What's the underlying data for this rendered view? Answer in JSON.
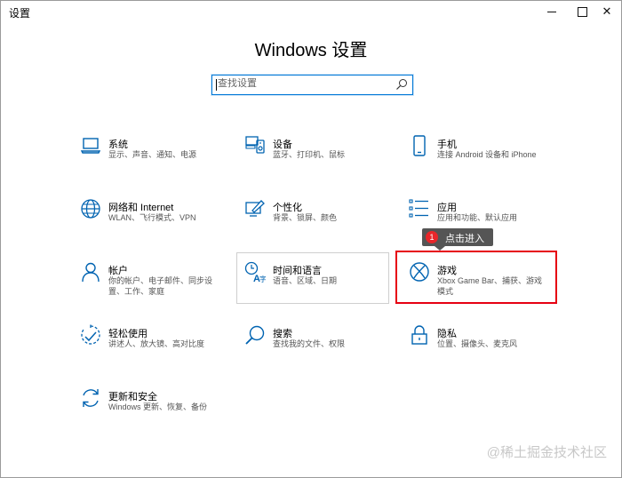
{
  "window": {
    "title": "设置",
    "minimize_glyph": "",
    "maximize_glyph": "",
    "close_glyph": "✕"
  },
  "header": {
    "title": "Windows 设置"
  },
  "search": {
    "value": "",
    "placeholder": "查找设置",
    "icon": "search-icon"
  },
  "accent_color": "#0078d7",
  "highlight_color": "#e60012",
  "tiles": [
    {
      "name": "系统",
      "desc": "显示、声音、通知、电源",
      "icon": "laptop-icon"
    },
    {
      "name": "设备",
      "desc": "蓝牙、打印机、鼠标",
      "icon": "devices-icon"
    },
    {
      "name": "手机",
      "desc": "连接 Android 设备和 iPhone",
      "icon": "phone-icon"
    },
    {
      "name": "网络和 Internet",
      "desc": "WLAN、飞行模式、VPN",
      "icon": "globe-icon"
    },
    {
      "name": "个性化",
      "desc": "背景、锁屏、颜色",
      "icon": "personalization-icon"
    },
    {
      "name": "应用",
      "desc": "应用和功能、默认应用",
      "icon": "apps-list-icon"
    },
    {
      "name": "帐户",
      "desc": "你的帐户、电子邮件、同步设置、工作、家庭",
      "icon": "person-icon"
    },
    {
      "name": "时间和语言",
      "desc": "语音、区域、日期",
      "icon": "time-language-icon"
    },
    {
      "name": "游戏",
      "desc": "Xbox Game Bar、捕获、游戏模式",
      "icon": "xbox-icon"
    },
    {
      "name": "轻松使用",
      "desc": "讲述人、放大镜、高对比度",
      "icon": "ease-of-access-icon"
    },
    {
      "name": "搜索",
      "desc": "查找我的文件、权限",
      "icon": "search-icon"
    },
    {
      "name": "隐私",
      "desc": "位置、摄像头、麦克风",
      "icon": "lock-icon"
    },
    {
      "name": "更新和安全",
      "desc": "Windows 更新、恢复、备份",
      "icon": "update-icon"
    }
  ],
  "callout": {
    "badge": "1",
    "text": "点击进入"
  },
  "watermark": "@稀土掘金技术社区"
}
